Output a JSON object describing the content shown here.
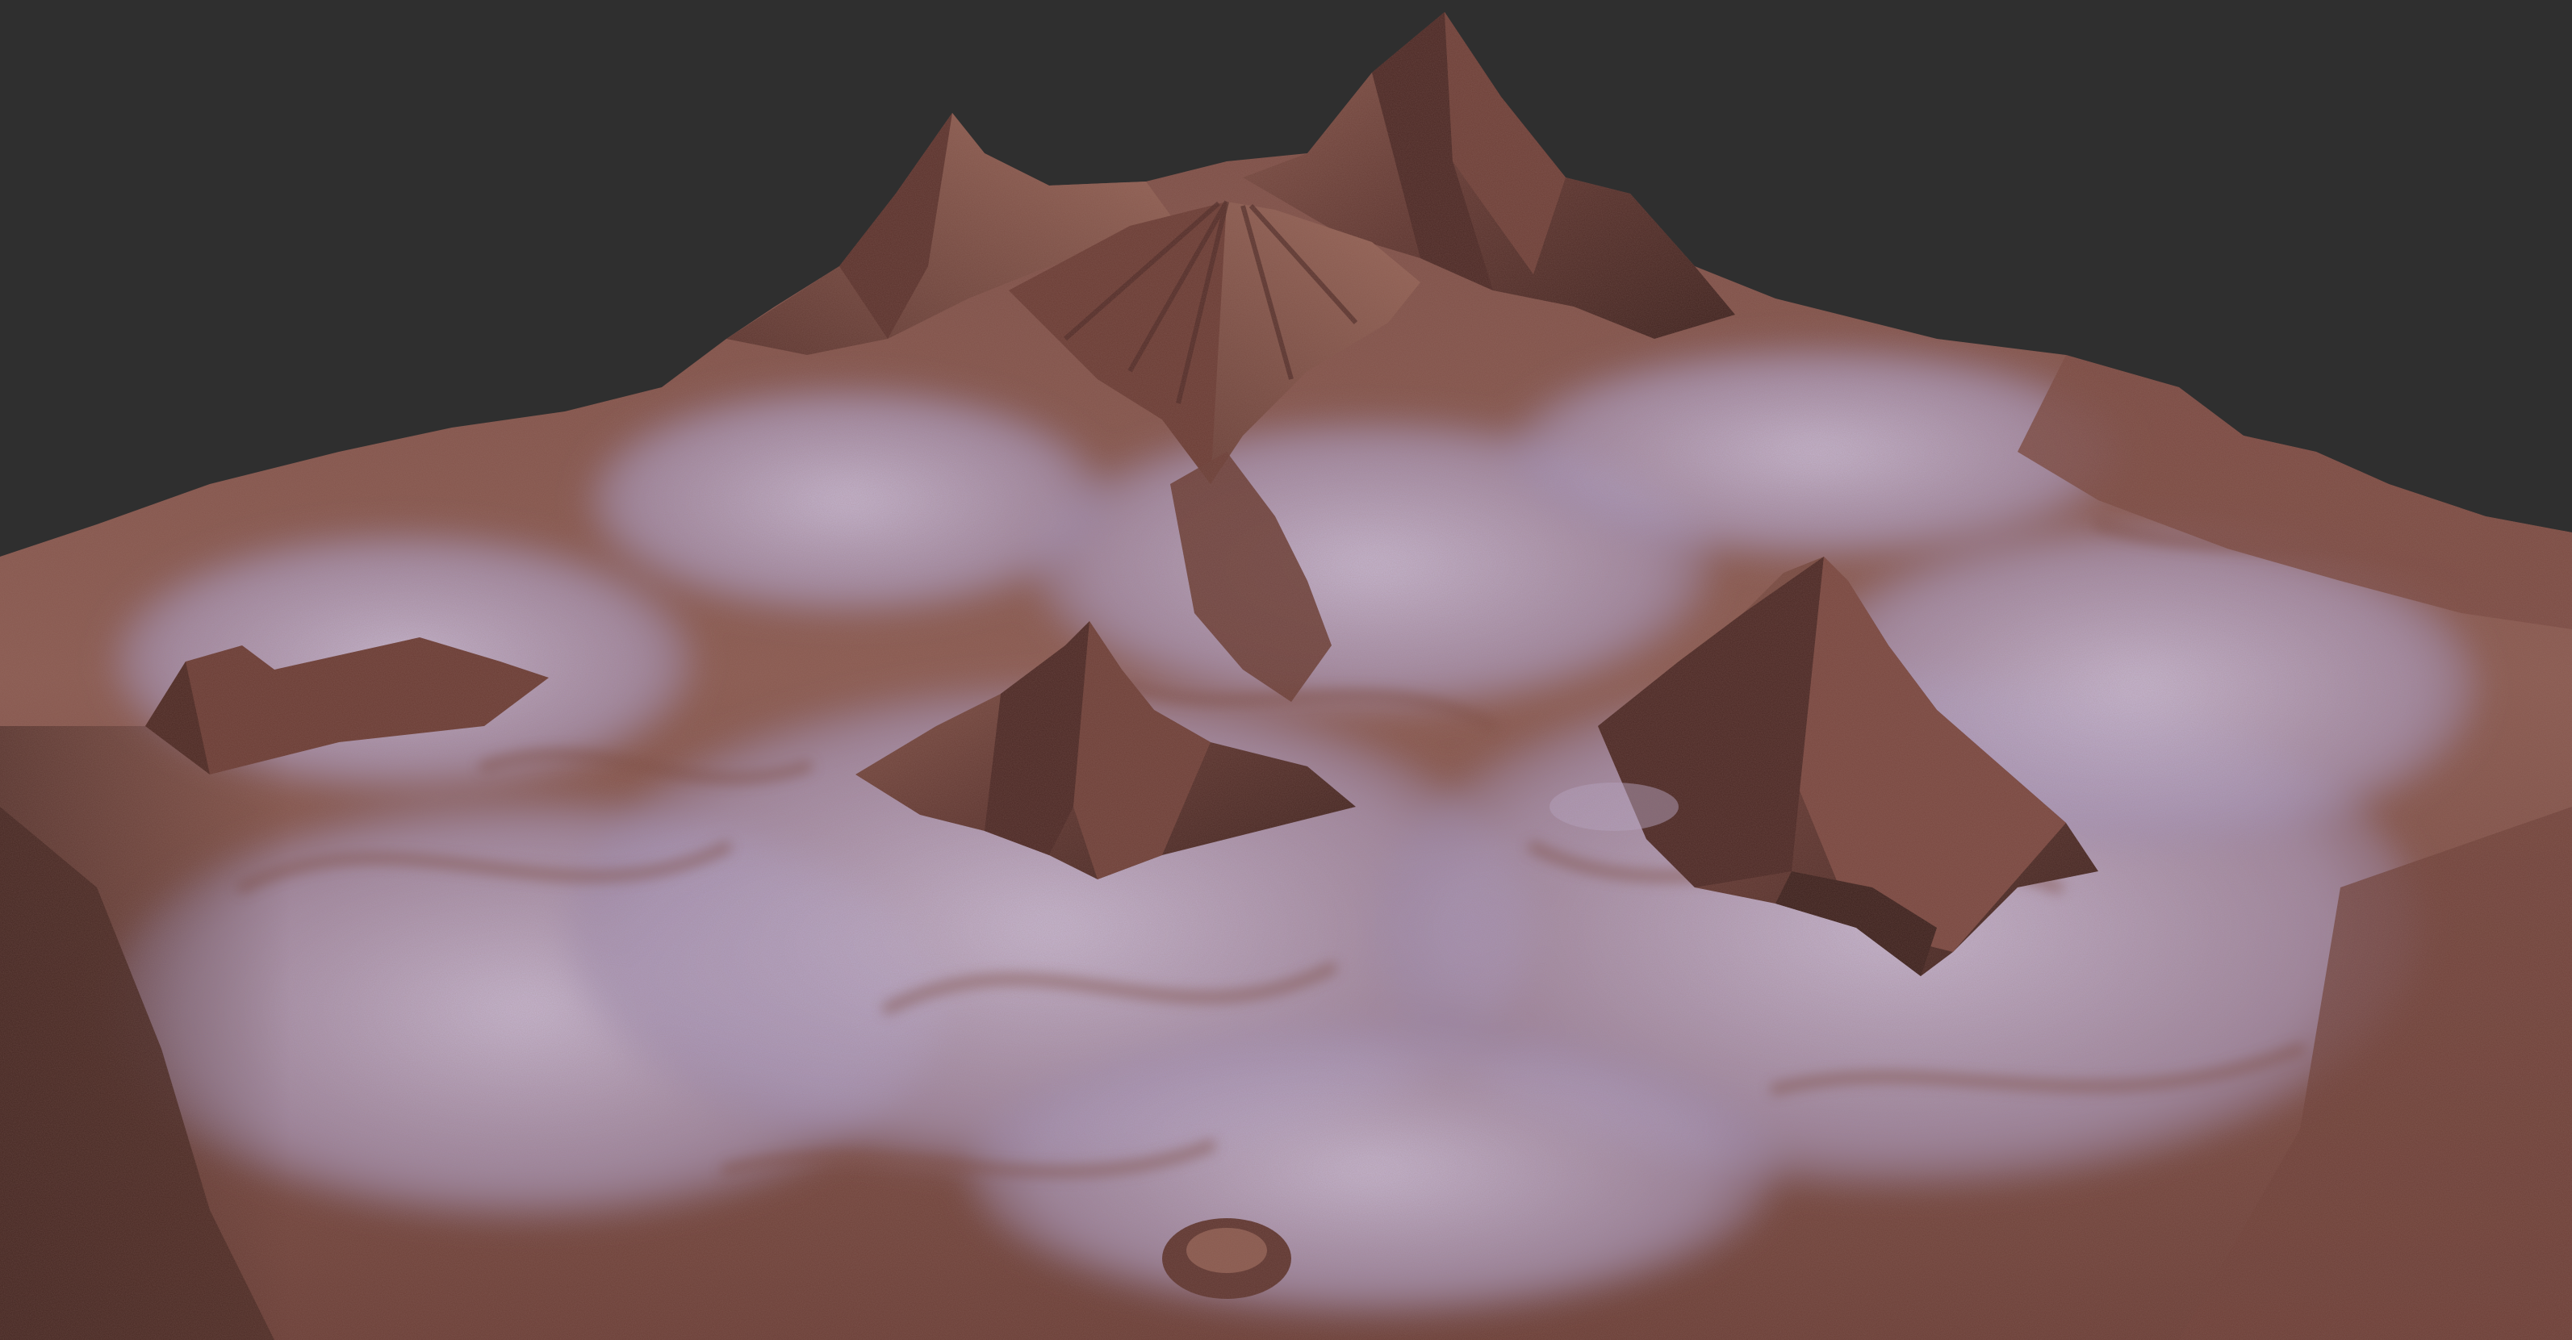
{
  "scene": {
    "type": "3d-terrain-render",
    "background_color": "#2f2f2f",
    "palette": {
      "rock_dark": "#4a2a25",
      "rock_mid": "#7a4a40",
      "rock_light": "#a06a5c",
      "frost": "#b8a8c8",
      "frost_light": "#d4c8e0",
      "shadow": "#2a1815"
    },
    "features": [
      "main-peak",
      "left-peak",
      "central-cone",
      "right-spire",
      "mid-left-peak",
      "frosted-plateau"
    ]
  }
}
